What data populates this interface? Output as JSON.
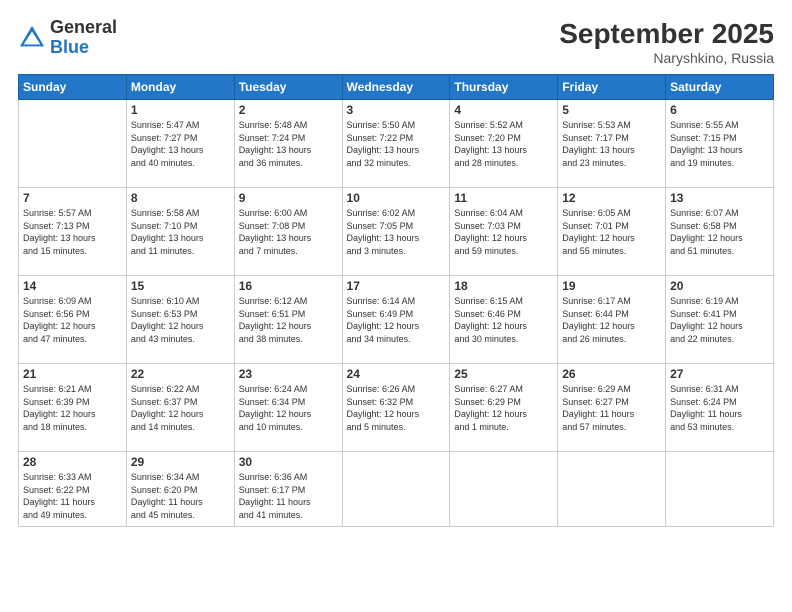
{
  "header": {
    "logo": {
      "line1": "General",
      "line2": "Blue"
    },
    "title": "September 2025",
    "location": "Naryshkino, Russia"
  },
  "days_of_week": [
    "Sunday",
    "Monday",
    "Tuesday",
    "Wednesday",
    "Thursday",
    "Friday",
    "Saturday"
  ],
  "weeks": [
    [
      {
        "day": "",
        "info": ""
      },
      {
        "day": "1",
        "info": "Sunrise: 5:47 AM\nSunset: 7:27 PM\nDaylight: 13 hours\nand 40 minutes."
      },
      {
        "day": "2",
        "info": "Sunrise: 5:48 AM\nSunset: 7:24 PM\nDaylight: 13 hours\nand 36 minutes."
      },
      {
        "day": "3",
        "info": "Sunrise: 5:50 AM\nSunset: 7:22 PM\nDaylight: 13 hours\nand 32 minutes."
      },
      {
        "day": "4",
        "info": "Sunrise: 5:52 AM\nSunset: 7:20 PM\nDaylight: 13 hours\nand 28 minutes."
      },
      {
        "day": "5",
        "info": "Sunrise: 5:53 AM\nSunset: 7:17 PM\nDaylight: 13 hours\nand 23 minutes."
      },
      {
        "day": "6",
        "info": "Sunrise: 5:55 AM\nSunset: 7:15 PM\nDaylight: 13 hours\nand 19 minutes."
      }
    ],
    [
      {
        "day": "7",
        "info": "Sunrise: 5:57 AM\nSunset: 7:13 PM\nDaylight: 13 hours\nand 15 minutes."
      },
      {
        "day": "8",
        "info": "Sunrise: 5:58 AM\nSunset: 7:10 PM\nDaylight: 13 hours\nand 11 minutes."
      },
      {
        "day": "9",
        "info": "Sunrise: 6:00 AM\nSunset: 7:08 PM\nDaylight: 13 hours\nand 7 minutes."
      },
      {
        "day": "10",
        "info": "Sunrise: 6:02 AM\nSunset: 7:05 PM\nDaylight: 13 hours\nand 3 minutes."
      },
      {
        "day": "11",
        "info": "Sunrise: 6:04 AM\nSunset: 7:03 PM\nDaylight: 12 hours\nand 59 minutes."
      },
      {
        "day": "12",
        "info": "Sunrise: 6:05 AM\nSunset: 7:01 PM\nDaylight: 12 hours\nand 55 minutes."
      },
      {
        "day": "13",
        "info": "Sunrise: 6:07 AM\nSunset: 6:58 PM\nDaylight: 12 hours\nand 51 minutes."
      }
    ],
    [
      {
        "day": "14",
        "info": "Sunrise: 6:09 AM\nSunset: 6:56 PM\nDaylight: 12 hours\nand 47 minutes."
      },
      {
        "day": "15",
        "info": "Sunrise: 6:10 AM\nSunset: 6:53 PM\nDaylight: 12 hours\nand 43 minutes."
      },
      {
        "day": "16",
        "info": "Sunrise: 6:12 AM\nSunset: 6:51 PM\nDaylight: 12 hours\nand 38 minutes."
      },
      {
        "day": "17",
        "info": "Sunrise: 6:14 AM\nSunset: 6:49 PM\nDaylight: 12 hours\nand 34 minutes."
      },
      {
        "day": "18",
        "info": "Sunrise: 6:15 AM\nSunset: 6:46 PM\nDaylight: 12 hours\nand 30 minutes."
      },
      {
        "day": "19",
        "info": "Sunrise: 6:17 AM\nSunset: 6:44 PM\nDaylight: 12 hours\nand 26 minutes."
      },
      {
        "day": "20",
        "info": "Sunrise: 6:19 AM\nSunset: 6:41 PM\nDaylight: 12 hours\nand 22 minutes."
      }
    ],
    [
      {
        "day": "21",
        "info": "Sunrise: 6:21 AM\nSunset: 6:39 PM\nDaylight: 12 hours\nand 18 minutes."
      },
      {
        "day": "22",
        "info": "Sunrise: 6:22 AM\nSunset: 6:37 PM\nDaylight: 12 hours\nand 14 minutes."
      },
      {
        "day": "23",
        "info": "Sunrise: 6:24 AM\nSunset: 6:34 PM\nDaylight: 12 hours\nand 10 minutes."
      },
      {
        "day": "24",
        "info": "Sunrise: 6:26 AM\nSunset: 6:32 PM\nDaylight: 12 hours\nand 5 minutes."
      },
      {
        "day": "25",
        "info": "Sunrise: 6:27 AM\nSunset: 6:29 PM\nDaylight: 12 hours\nand 1 minute."
      },
      {
        "day": "26",
        "info": "Sunrise: 6:29 AM\nSunset: 6:27 PM\nDaylight: 11 hours\nand 57 minutes."
      },
      {
        "day": "27",
        "info": "Sunrise: 6:31 AM\nSunset: 6:24 PM\nDaylight: 11 hours\nand 53 minutes."
      }
    ],
    [
      {
        "day": "28",
        "info": "Sunrise: 6:33 AM\nSunset: 6:22 PM\nDaylight: 11 hours\nand 49 minutes."
      },
      {
        "day": "29",
        "info": "Sunrise: 6:34 AM\nSunset: 6:20 PM\nDaylight: 11 hours\nand 45 minutes."
      },
      {
        "day": "30",
        "info": "Sunrise: 6:36 AM\nSunset: 6:17 PM\nDaylight: 11 hours\nand 41 minutes."
      },
      {
        "day": "",
        "info": ""
      },
      {
        "day": "",
        "info": ""
      },
      {
        "day": "",
        "info": ""
      },
      {
        "day": "",
        "info": ""
      }
    ]
  ]
}
